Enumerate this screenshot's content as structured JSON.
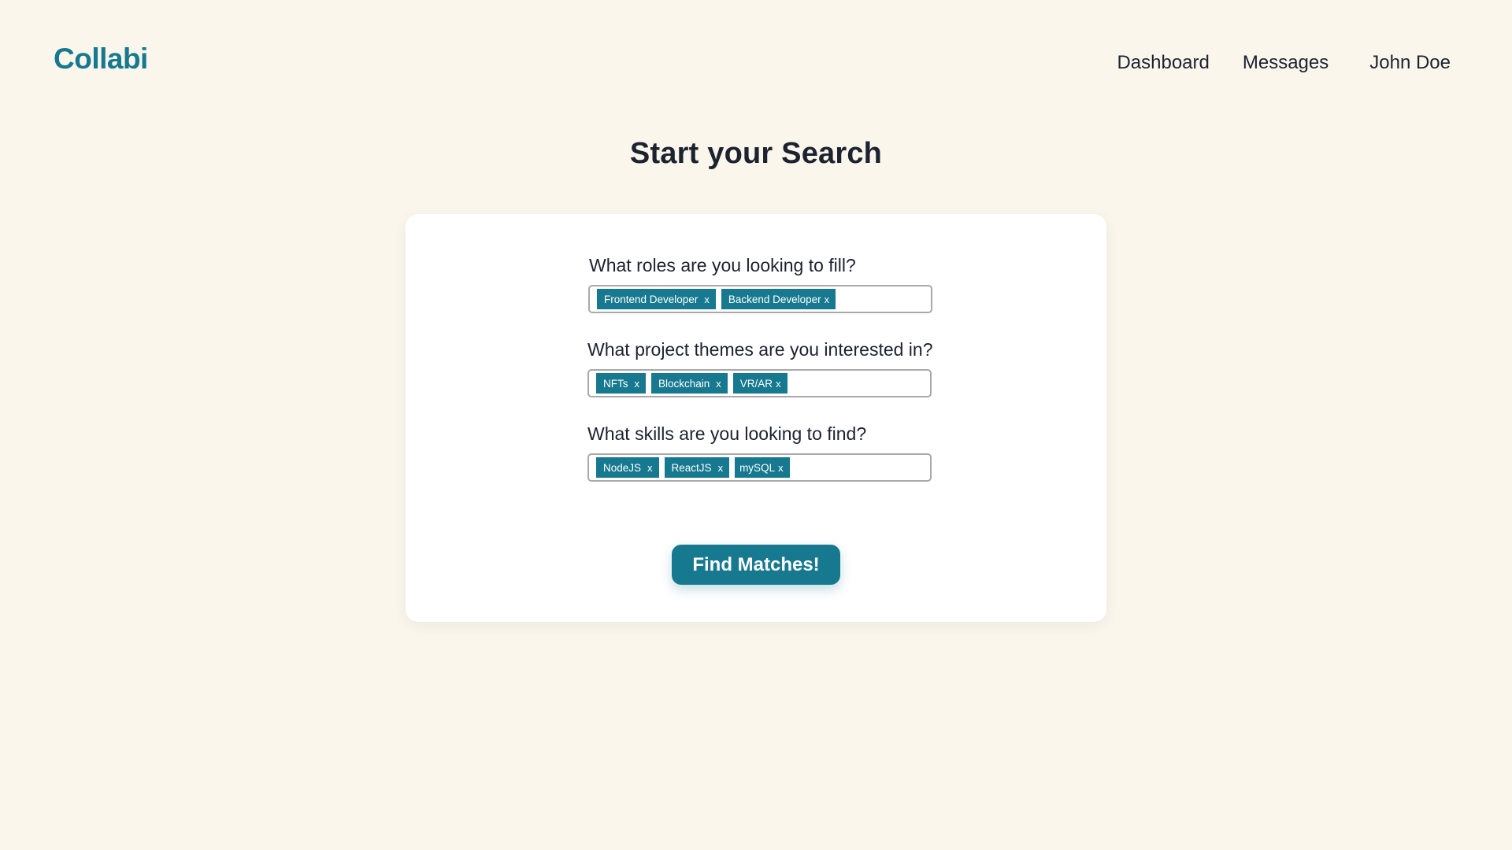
{
  "brand": {
    "logo": "Collabi",
    "accent_color": "#17798f"
  },
  "nav": {
    "dashboard": "Dashboard",
    "messages": "Messages",
    "user_name": "John Doe"
  },
  "page": {
    "title": "Start your Search"
  },
  "form": {
    "roles": {
      "question": "What roles are you looking to fill?",
      "tags": [
        "Frontend Developer",
        "Backend Developer"
      ]
    },
    "themes": {
      "question": "What project themes are you interested in?",
      "tags": [
        "NFTs",
        "Blockchain",
        "VR/AR"
      ]
    },
    "skills": {
      "question": "What skills are you looking to find?",
      "tags": [
        "NodeJS",
        "ReactJS",
        "mySQL"
      ]
    },
    "remove_label": "x",
    "submit_label": "Find Matches!"
  }
}
